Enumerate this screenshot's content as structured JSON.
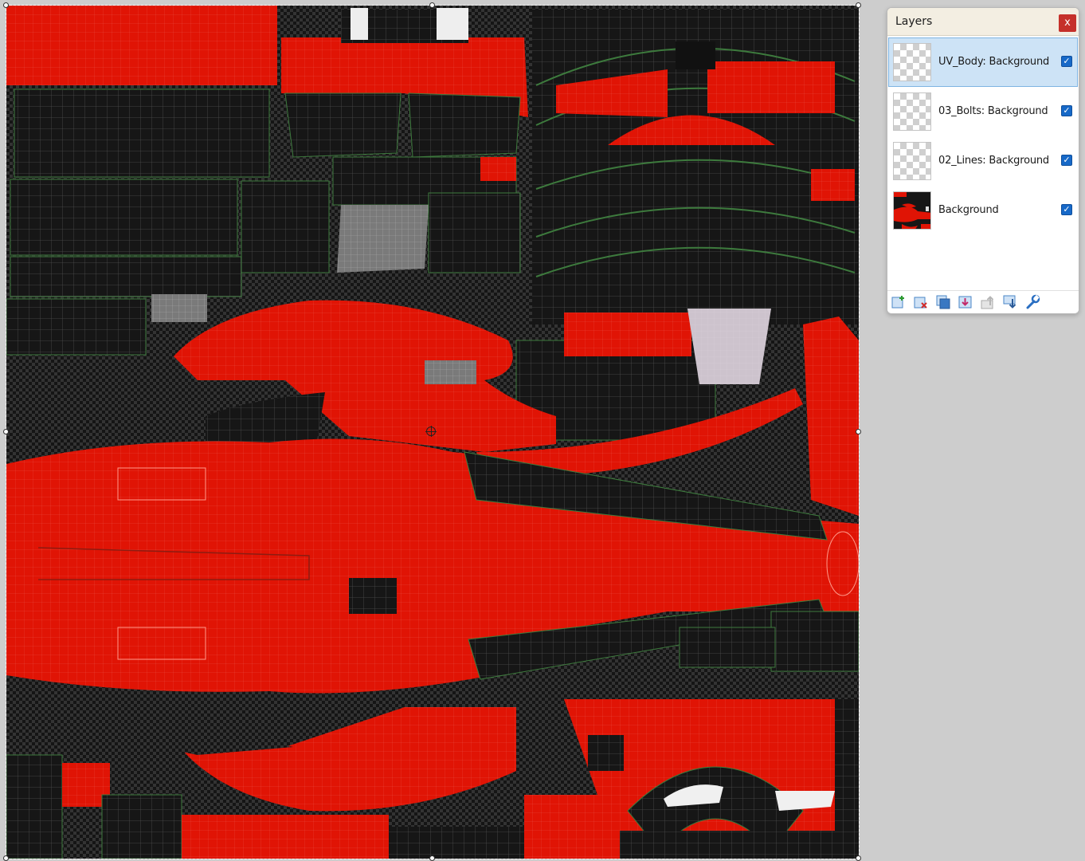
{
  "panel": {
    "title": "Layers",
    "close_label": "x"
  },
  "layers": [
    {
      "name": "UV_Body: Background",
      "visible": true,
      "selected": true,
      "thumb": "transparent"
    },
    {
      "name": "03_Bolts: Background",
      "visible": true,
      "selected": false,
      "thumb": "transparent"
    },
    {
      "name": "02_Lines: Background",
      "visible": true,
      "selected": false,
      "thumb": "transparent"
    },
    {
      "name": "Background",
      "visible": true,
      "selected": false,
      "thumb": "image"
    }
  ],
  "toolbar": [
    {
      "name": "add-layer-icon"
    },
    {
      "name": "delete-layer-icon"
    },
    {
      "name": "duplicate-layer-icon"
    },
    {
      "name": "merge-down-icon"
    },
    {
      "name": "move-layer-up-icon"
    },
    {
      "name": "move-layer-down-icon"
    },
    {
      "name": "layer-properties-icon"
    }
  ],
  "colors": {
    "texture_red": "#e01405",
    "texture_dark": "#161616",
    "wire": "#5a5a5a",
    "seam": "#3d7a3d",
    "accent": "#1769c8",
    "workspace": "#cdcdcd"
  },
  "check_glyph": "✓"
}
